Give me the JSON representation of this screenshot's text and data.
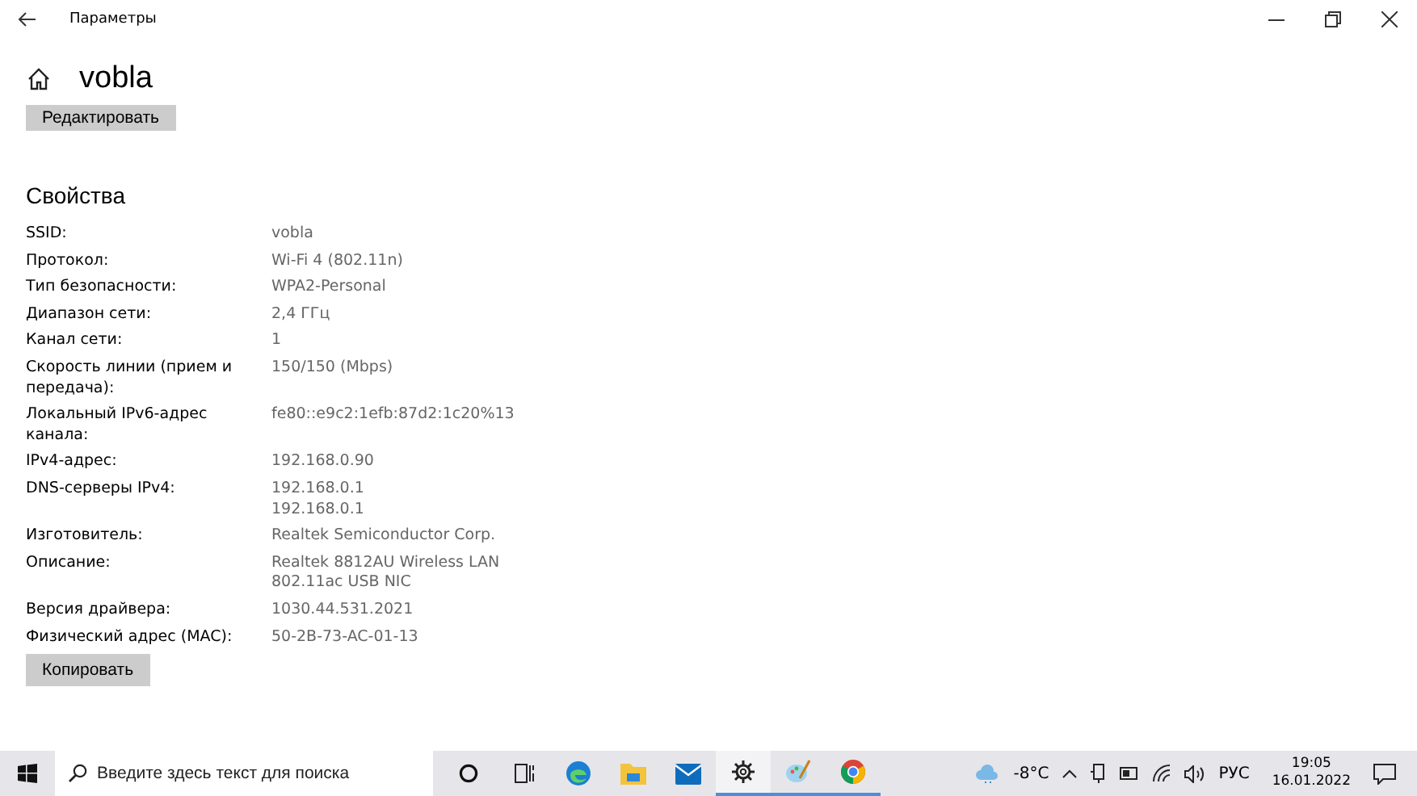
{
  "window": {
    "title": "Параметры"
  },
  "header": {
    "title": "vobla"
  },
  "edit_button": "Редактировать",
  "properties": {
    "heading": "Свойства",
    "rows": [
      {
        "label": "SSID:",
        "values": [
          "vobla"
        ]
      },
      {
        "label": "Протокол:",
        "values": [
          "Wi-Fi 4 (802.11n)"
        ]
      },
      {
        "label": "Тип безопасности:",
        "values": [
          "WPA2-Personal"
        ]
      },
      {
        "label": "Диапазон сети:",
        "values": [
          "2,4 ГГц"
        ]
      },
      {
        "label": "Канал сети:",
        "values": [
          "1"
        ]
      },
      {
        "label": "Скорость линии (прием и передача):",
        "values": [
          "150/150 (Mbps)"
        ]
      },
      {
        "label": "Локальный IPv6-адрес канала:",
        "values": [
          "fe80::e9c2:1efb:87d2:1c20%13"
        ]
      },
      {
        "label": "IPv4-адрес:",
        "values": [
          "192.168.0.90"
        ]
      },
      {
        "label": "DNS-серверы IPv4:",
        "values": [
          "192.168.0.1",
          "192.168.0.1"
        ]
      },
      {
        "label": "Изготовитель:",
        "values": [
          "Realtek Semiconductor Corp."
        ]
      },
      {
        "label": "Описание:",
        "values": [
          "Realtek 8812AU Wireless LAN",
          "802.11ac USB NIC"
        ]
      },
      {
        "label": "Версия драйвера:",
        "values": [
          "1030.44.531.2021"
        ]
      },
      {
        "label": "Физический адрес (MAC):",
        "values": [
          "50-2B-73-AC-01-13"
        ]
      }
    ],
    "copy_button": "Копировать"
  },
  "taskbar": {
    "search": {
      "placeholder": "Введите здесь текст для поиска"
    },
    "apps": [
      {
        "kind": "cortana",
        "running": false,
        "selected": false
      },
      {
        "kind": "taskview",
        "running": false,
        "selected": false
      },
      {
        "kind": "edge",
        "running": false,
        "selected": false
      },
      {
        "kind": "explorer",
        "running": false,
        "selected": false
      },
      {
        "kind": "mail",
        "running": false,
        "selected": false
      },
      {
        "kind": "settings",
        "running": true,
        "selected": true
      },
      {
        "kind": "paint",
        "running": true,
        "selected": false
      },
      {
        "kind": "chrome",
        "running": true,
        "selected": false
      }
    ],
    "temperature": "-8°C",
    "language": "РУС",
    "time": "19:05",
    "date": "16.01.2022"
  }
}
